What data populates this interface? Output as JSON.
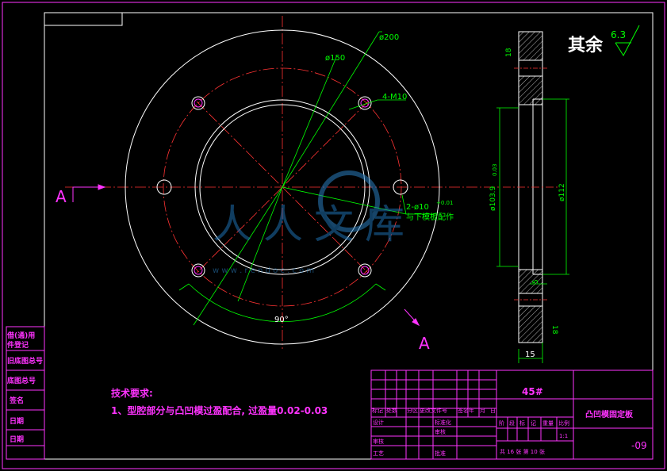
{
  "dimensions": {
    "d200": "ø200",
    "d150": "ø150",
    "holes": "4-M10",
    "pins_line1": "2-ø10",
    "pins_tol": "+0.01",
    "pins_line2": "与下模板配作",
    "angle": "90°",
    "d103": "ø103.9",
    "d103_fit": "0.03",
    "d112": "ø112",
    "t18_top": "18",
    "t18_bot": "18",
    "t5": "5",
    "t15": "15",
    "section_a": "A"
  },
  "roughness": {
    "label": "其余",
    "value": "6.3"
  },
  "watermark": {
    "text": "人人文库",
    "url": "w w w . r e n d o c . c o m"
  },
  "tech": {
    "heading": "技术要求:",
    "item1": "1、型腔部分与凸凹模过盈配合, 过盈量0.02-0.03"
  },
  "left_strip": [
    "借(通)用",
    "件登记",
    "旧底图总号",
    "底图总号",
    "签名",
    "日期",
    "日期"
  ],
  "title_block": {
    "material": "45#",
    "part_name": "凸凹模固定板",
    "drawing_no": "-09",
    "rev_headers": [
      "标记",
      "处数",
      "分区",
      "更改文件号",
      "签名",
      "年",
      "月",
      "日"
    ],
    "roles_left": [
      "设计",
      "审核",
      "工艺"
    ],
    "roles_mid": [
      "标准化",
      "审核",
      "批准"
    ],
    "stage_headers": [
      "阶",
      "段",
      "标",
      "记",
      "重量",
      "比例"
    ],
    "scale": "1:1",
    "sheet": "共 16 张   第 10 张"
  }
}
